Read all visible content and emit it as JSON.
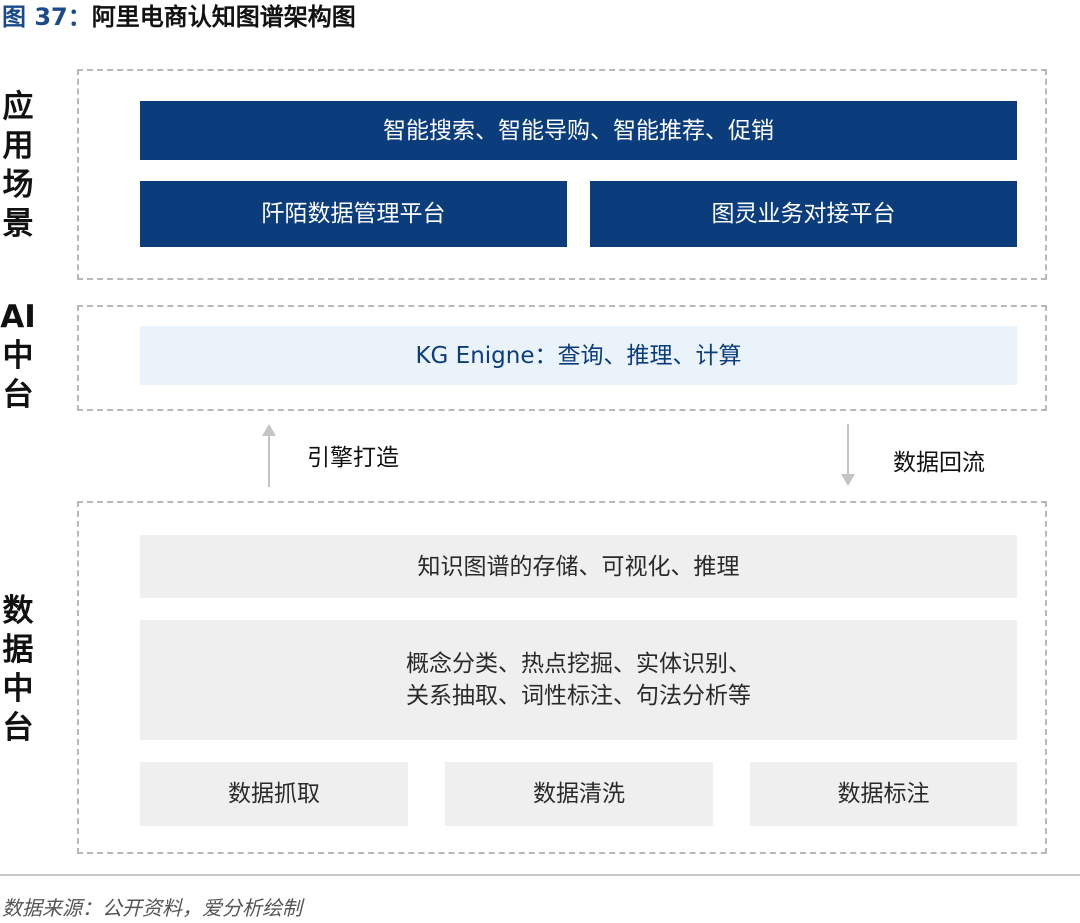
{
  "figure": {
    "number": "图 37：",
    "title": "阿里电商认知图谱架构图"
  },
  "layers": {
    "application": {
      "label": "应用场景",
      "items": [
        "智能搜索、智能导购、智能推荐、促销",
        "阡陌数据管理平台",
        "图灵业务对接平台"
      ]
    },
    "ai_platform": {
      "label": "AI中台",
      "items": [
        "KG Enigne：查询、推理、计算"
      ]
    },
    "data_platform": {
      "label": "数据中台",
      "items": [
        "知识图谱的存储、可视化、推理",
        "概念分类、热点挖掘、实体识别、",
        "关系抽取、词性标注、句法分析等",
        "数据抓取",
        "数据清洗",
        "数据标注"
      ]
    }
  },
  "flows": {
    "up_label": "引擎打造",
    "down_label": "数据回流"
  },
  "source": "数据来源：公开资料，爱分析绘制",
  "colors": {
    "dark_blue": "#0b3d7d",
    "light_blue": "#eaf3fa",
    "grey": "#efefef",
    "title_blue": "#1a4a8a"
  }
}
